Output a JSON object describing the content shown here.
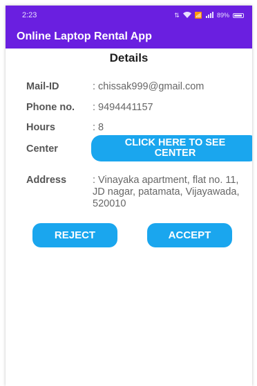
{
  "status_bar": {
    "time": "2:23",
    "icons": [
      "data-icon",
      "wifi-icon",
      "volte-icon",
      "signal-icon",
      "battery-icon"
    ],
    "battery_text": "89%"
  },
  "app_bar": {
    "title": "Online Laptop Rental App"
  },
  "details": {
    "heading": "Details",
    "mail": {
      "label": "Mail-ID",
      "value": ": chissak999@gmail.com"
    },
    "phone": {
      "label": "Phone no.",
      "value": ": 9494441157"
    },
    "hours": {
      "label": "Hours",
      "value": ": 8"
    },
    "center": {
      "label": "Center",
      "button": "CLICK HERE TO SEE CENTER"
    },
    "address": {
      "label": "Address",
      "value": ": Vinayaka apartment, flat no. 11, JD nagar, patamata, Vijayawada, 520010"
    }
  },
  "actions": {
    "reject": "REJECT",
    "accept": "ACCEPT"
  },
  "colors": {
    "primary": "#6a1fe0",
    "button": "#1aa6ee"
  }
}
